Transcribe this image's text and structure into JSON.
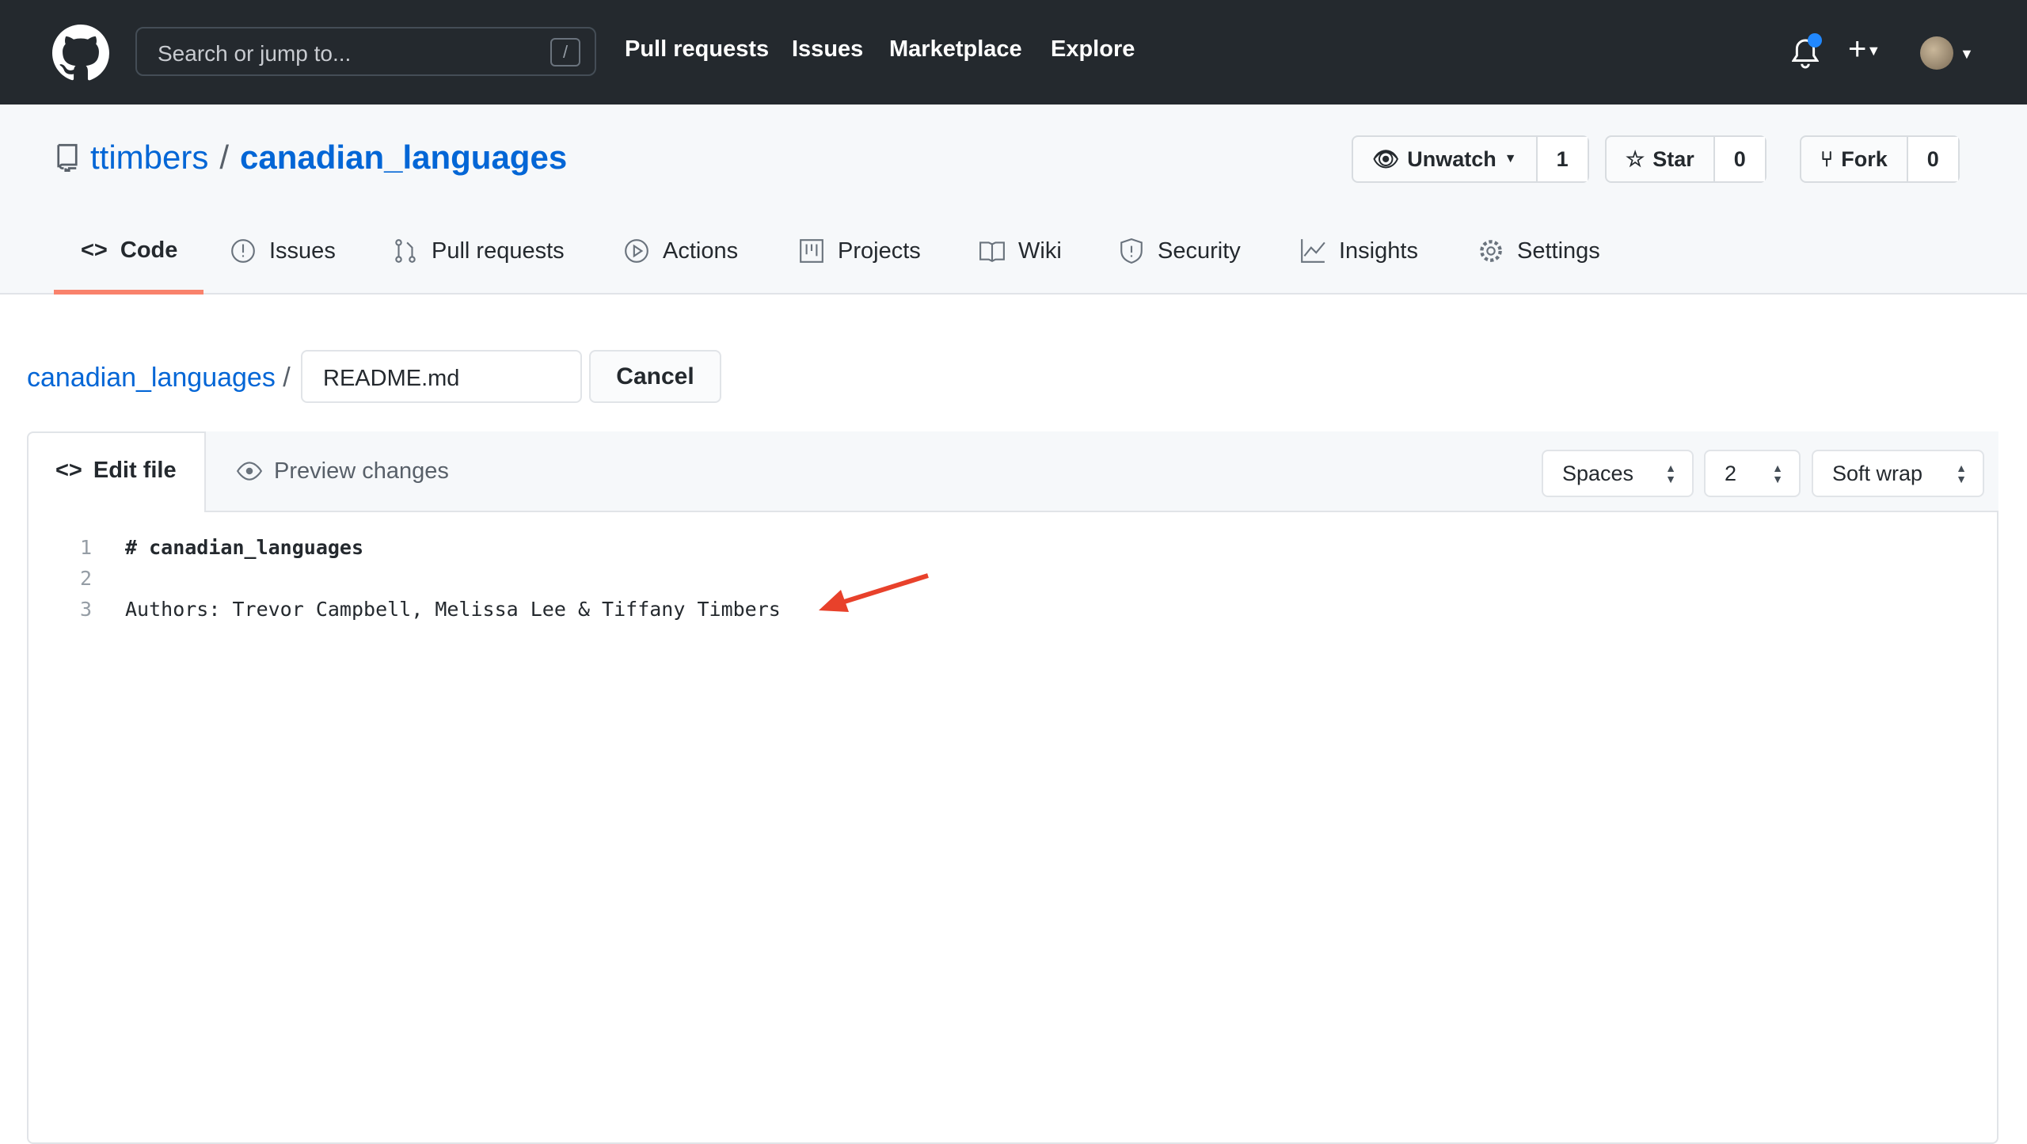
{
  "topbar": {
    "search_placeholder": "Search or jump to...",
    "slash_key": "/",
    "links": [
      "Pull requests",
      "Issues",
      "Marketplace",
      "Explore"
    ]
  },
  "repo": {
    "owner": "ttimbers",
    "separator": "/",
    "name": "canadian_languages",
    "unwatch_label": "Unwatch",
    "watch_count": "1",
    "star_label": "Star",
    "star_count": "0",
    "fork_label": "Fork",
    "fork_count": "0"
  },
  "tabs": [
    {
      "label": "Code"
    },
    {
      "label": "Issues"
    },
    {
      "label": "Pull requests"
    },
    {
      "label": "Actions"
    },
    {
      "label": "Projects"
    },
    {
      "label": "Wiki"
    },
    {
      "label": "Security"
    },
    {
      "label": "Insights"
    },
    {
      "label": "Settings"
    }
  ],
  "editor": {
    "breadcrumb_repo": "canadian_languages",
    "breadcrumb_sep": "/",
    "filename": "README.md",
    "cancel_label": "Cancel",
    "edit_tab": "Edit file",
    "preview_tab": "Preview changes",
    "indent_mode": "Spaces",
    "indent_size": "2",
    "wrap_mode": "Soft wrap",
    "lines": [
      {
        "n": "1",
        "text": "# canadian_languages"
      },
      {
        "n": "2",
        "text": ""
      },
      {
        "n": "3",
        "text": "Authors: Trevor Campbell, Melissa Lee & Tiffany Timbers"
      }
    ]
  },
  "colors": {
    "accent": "#0366d6",
    "annotation_arrow": "#e8412b",
    "tab_underline": "#f9826c"
  }
}
